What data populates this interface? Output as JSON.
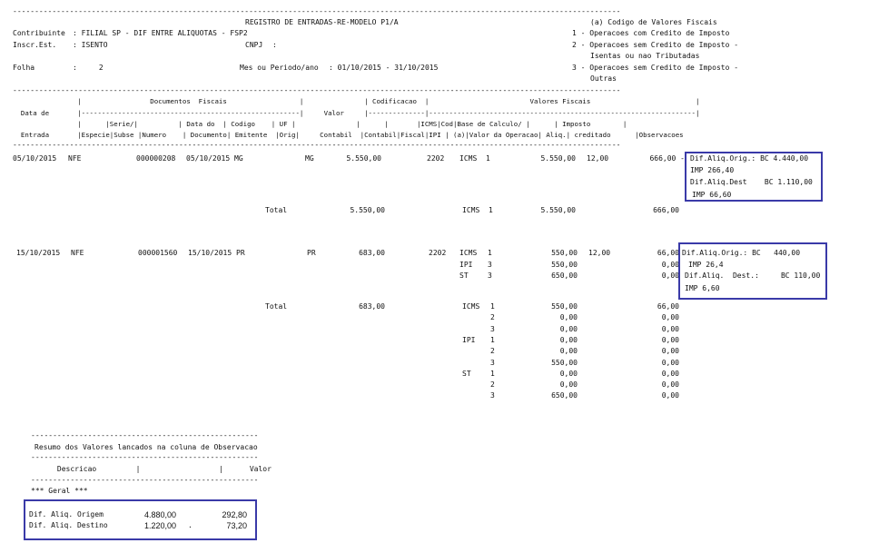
{
  "report": {
    "rule": "-------------------------------------------------------------------------------------------------------------------------------------------",
    "title": "REGISTRO DE ENTRADAS-RE-MODELO P1/A",
    "contribuinte_label": "Contribuinte",
    "contribuinte_value": ": FILIAL SP - DIF ENTRE ALIQUOTAS - FSP2",
    "inscr_label": "Inscr.Est.",
    "inscr_value": ": ISENTO",
    "cnpj_label": "CNPJ",
    "cnpj_value": ":",
    "folha_label": "Folha",
    "folha_value": ":     2",
    "periodo_label": "Mes ou Periodo/ano",
    "periodo_value": ": 01/10/2015 - 31/10/2015",
    "legend_title": "(a) Codigo de Valores Fiscais",
    "legend_1": "1 - Operacoes com Credito de Imposto",
    "legend_2a": "2 - Operacoes sem Credito de Imposto -",
    "legend_2b": "Isentas ou nao Tributadas",
    "legend_3a": "3 - Operacoes sem Credito de Imposto -",
    "legend_3b": "Outras"
  },
  "header": {
    "line1": "                |                 Documentos  Fiscais                  |               | Codificacao  |                         Valores Fiscais                          |",
    "line2": "  Data de       |------------------------------------------------------|     Valor     |--------------|------------------------------------------------------------------|",
    "line3": "                |      |Serie/|          | Data do  | Codigo    | UF |               |      |       |ICMS|Cod|Base de Calculo/ |      | Imposto        |",
    "line4": "  Entrada       |Especie|Subse |Numero    | Documento| Emitente  |Orig|     Contabil  |Contabil|Fiscal|IPI | (a)|Valor da Operacao| Aliq.| creditado      |Observacoes"
  },
  "entries": [
    {
      "data": "05/10/2015",
      "especie": "NFE",
      "numero": "000000208",
      "data_doc": "05/10/2015",
      "emitente": "MG",
      "uf": "MG",
      "valor": "5.550,00",
      "fiscal": "2202",
      "lines": [
        {
          "imp": "ICMS",
          "cod": "1",
          "base": "5.550,00",
          "aliq": "12,00",
          "credito": "666,00 -"
        }
      ],
      "obs": [
        "Dif.Aliq.Orig.: BC 4.440,00",
        "IMP 266,40",
        "Dif.Aliq.Dest    BC 1.110,00",
        "IMP 66,60"
      ],
      "total_label": "Total",
      "total_valor": "5.550,00",
      "totals": [
        {
          "imp": "ICMS",
          "cod": "1",
          "base": "5.550,00",
          "credito": "666,00"
        }
      ]
    },
    {
      "data": "15/10/2015",
      "especie": "NFE",
      "numero": "000001560",
      "data_doc": "15/10/2015",
      "emitente": "PR",
      "uf": "PR",
      "valor": "683,00",
      "fiscal": "2202",
      "lines": [
        {
          "imp": "ICMS",
          "cod": "1",
          "base": "550,00",
          "aliq": "12,00",
          "credito": "66,00"
        },
        {
          "imp": "IPI",
          "cod": "3",
          "base": "550,00",
          "aliq": "",
          "credito": "0,00"
        },
        {
          "imp": "ST",
          "cod": "3",
          "base": "650,00",
          "aliq": "",
          "credito": "0,00"
        }
      ],
      "obs": [
        "Dif.Aliq.Orig.: BC   440,00",
        "IMP 26,4",
        "Dif.Aliq.  Dest.:     BC 110,00",
        "IMP 6,60"
      ],
      "total_label": "Total",
      "total_valor": "683,00",
      "totals": [
        {
          "imp": "ICMS",
          "cod": "1",
          "base": "550,00",
          "credito": "66,00"
        },
        {
          "imp": "",
          "cod": "2",
          "base": "0,00",
          "credito": "0,00"
        },
        {
          "imp": "",
          "cod": "3",
          "base": "0,00",
          "credito": "0,00"
        },
        {
          "imp": "IPI",
          "cod": "1",
          "base": "0,00",
          "credito": "0,00"
        },
        {
          "imp": "",
          "cod": "2",
          "base": "0,00",
          "credito": "0,00"
        },
        {
          "imp": "",
          "cod": "3",
          "base": "550,00",
          "credito": "0,00"
        },
        {
          "imp": "ST",
          "cod": "1",
          "base": "0,00",
          "credito": "0,00"
        },
        {
          "imp": "",
          "cod": "2",
          "base": "0,00",
          "credito": "0,00"
        },
        {
          "imp": "",
          "cod": "3",
          "base": "650,00",
          "credito": "0,00"
        }
      ]
    }
  ],
  "summary": {
    "rule": "----------------------------------------------------",
    "title": "Resumo dos Valores lancados na coluna de Observacao",
    "header": "      Descricao         |                  |      Valor",
    "geral": "*** Geral ***",
    "rows": [
      {
        "desc": "Dif. Aliq. Origem",
        "base": "4.880,00",
        "valor": "292,80",
        "dot": ""
      },
      {
        "desc": "Dif. Aliq. Destino",
        "base": "1.220,00",
        "valor": "73,20",
        "dot": "."
      }
    ]
  }
}
